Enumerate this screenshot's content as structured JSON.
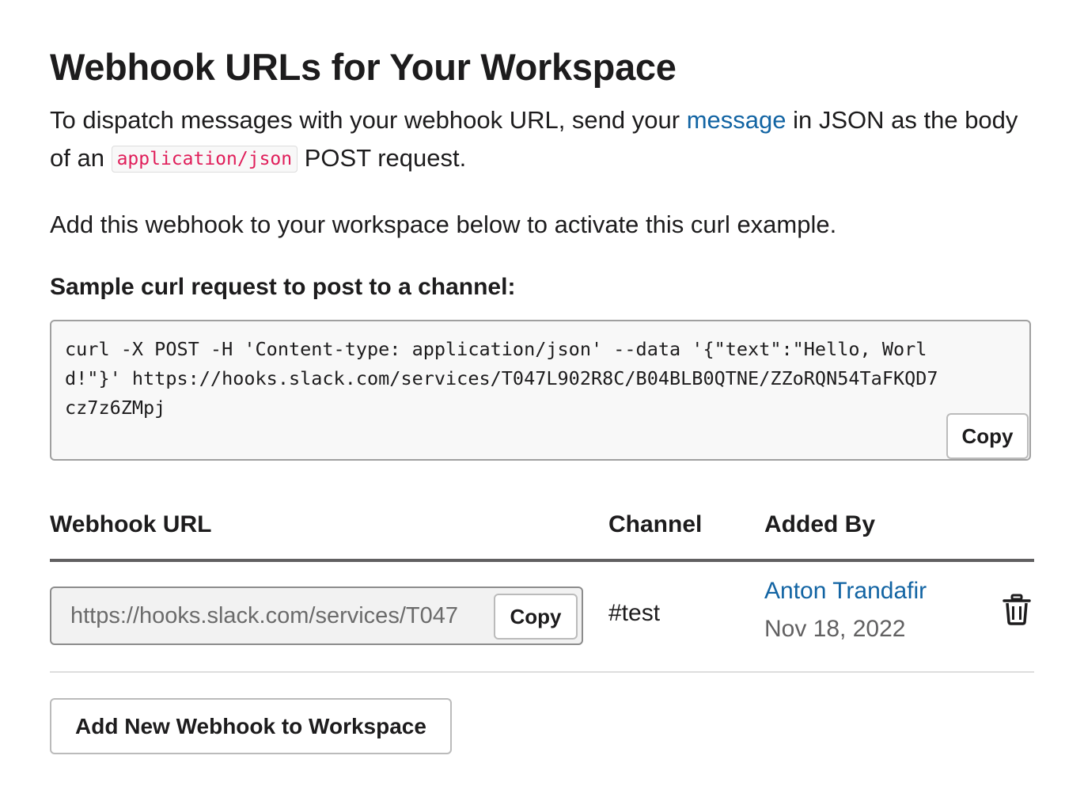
{
  "header": {
    "title": "Webhook URLs for Your Workspace"
  },
  "intro": {
    "text_before_link": "To dispatch messages with your webhook URL, send your ",
    "link_text": "message",
    "text_after_link": " in JSON as the body of an ",
    "code": "application/json",
    "text_end": " POST request."
  },
  "activate_text": "Add this webhook to your workspace below to activate this curl example.",
  "sample": {
    "heading": "Sample curl request to post to a channel:",
    "code": "curl -X POST -H 'Content-type: application/json' --data '{\"text\":\"Hello, World!\"}' https://hooks.slack.com/services/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",
    "copy_label": "Copy"
  },
  "table": {
    "headers": {
      "url": "Webhook URL",
      "channel": "Channel",
      "added_by": "Added By"
    },
    "rows": [
      {
        "url_value": "https://hooks.slack.com/services/T047",
        "copy_label": "Copy",
        "channel": "#test",
        "added_by": "Anton Trandafir",
        "date": "Nov 18, 2022",
        "delete_icon": "trash-icon"
      }
    ]
  },
  "add_button_label": "Add New Webhook to Workspace",
  "colors": {
    "link": "#1264a3",
    "code_text": "#e01e5a",
    "text": "#1d1c1d",
    "muted": "#616061"
  }
}
